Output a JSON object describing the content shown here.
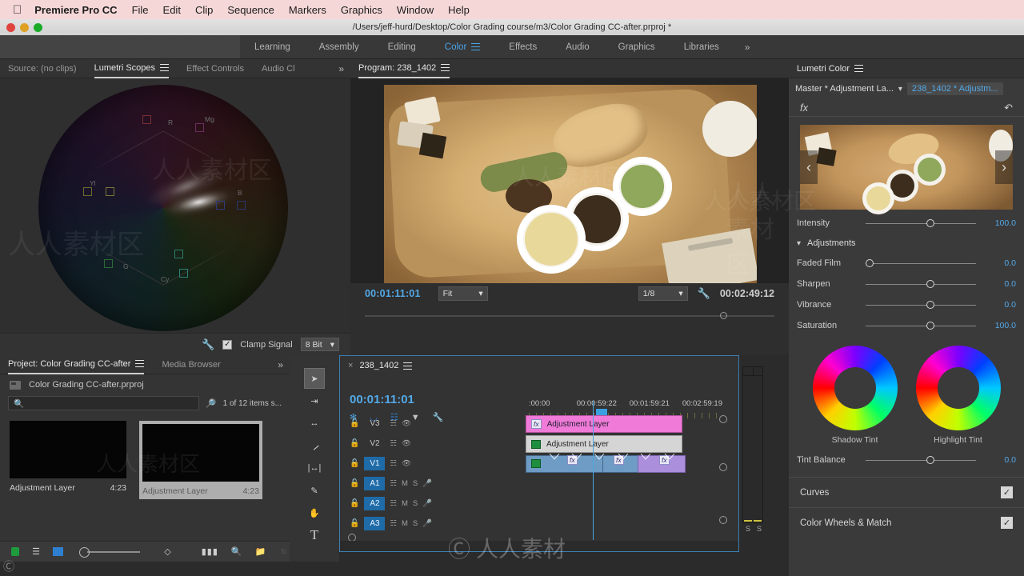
{
  "macbar": {
    "apple": "apple-logo",
    "app": "Premiere Pro CC",
    "menus": [
      "File",
      "Edit",
      "Clip",
      "Sequence",
      "Markers",
      "Graphics",
      "Window",
      "Help"
    ]
  },
  "titlebar": {
    "path": "/Users/jeff-hurd/Desktop/Color Grading course/m3/Color Grading CC-after.prproj *"
  },
  "workspace": {
    "tabs": [
      "Learning",
      "Assembly",
      "Editing",
      "Color",
      "Effects",
      "Audio",
      "Graphics",
      "Libraries"
    ],
    "active": "Color",
    "overflow": "»"
  },
  "scopes": {
    "tabs": [
      "Source: (no clips)",
      "Lumetri Scopes",
      "Effect Controls",
      "Audio Cl"
    ],
    "active": "Lumetri Scopes",
    "overflow": "»",
    "vector_labels": [
      "R",
      "Mg",
      "Yl",
      "B",
      "G",
      "Cy"
    ],
    "footer": {
      "wrench": "wrench-icon",
      "clamp_label": "Clamp Signal",
      "clamp_checked": true,
      "bitdepth": "8 Bit"
    }
  },
  "program": {
    "tab": "Program: 238_1402",
    "current_time": "00:01:11:01",
    "fit": "Fit",
    "resolution": "1/8",
    "duration": "00:02:49:12",
    "wrench": "wrench-icon"
  },
  "project": {
    "tabs": [
      "Project: Color Grading CC-after",
      "Media Browser"
    ],
    "active": "Project: Color Grading CC-after",
    "overflow": "»",
    "file": "Color Grading CC-after.prproj",
    "search_placeholder": "",
    "item_count": "1 of 12 items s...",
    "items": [
      {
        "name": "Adjustment Layer",
        "duration": "4:23",
        "selected": false
      },
      {
        "name": "Adjustment Layer",
        "duration": "4:23",
        "selected": true
      }
    ],
    "footer_icons": [
      "new-bin-icon",
      "list-view-icon",
      "icon-view-icon",
      "zoom-slider",
      "sort-icon",
      "freeform-icon",
      "find-icon",
      "new-bin-folder-icon",
      "new-item-icon"
    ]
  },
  "tools": [
    "selection-tool",
    "track-select-forward-tool",
    "ripple-edit-tool",
    "razor-tool",
    "slip-tool",
    "pen-tool",
    "hand-tool",
    "type-tool"
  ],
  "timeline": {
    "close": "×",
    "name": "238_1402",
    "menu": "panel-menu-icon",
    "playhead_time": "00:01:11:01",
    "ruler_labels": [
      ":00:00",
      "00:00:59:22",
      "00:01:59:21",
      "00:02:59:19"
    ],
    "header_icons": [
      "snap-sequence-icon",
      "magnet-icon",
      "linked-selection-icon",
      "marker-icon",
      "settings-wrench-icon"
    ],
    "video_tracks": [
      {
        "name": "V3",
        "active": false,
        "eye": true
      },
      {
        "name": "V2",
        "active": false,
        "eye": true
      },
      {
        "name": "V1",
        "active": true,
        "eye": true
      }
    ],
    "audio_tracks": [
      {
        "name": "A1",
        "active": true,
        "m": "M",
        "s": "S"
      },
      {
        "name": "A2",
        "active": true,
        "m": "M",
        "s": "S"
      },
      {
        "name": "A3",
        "active": true,
        "m": "M",
        "s": "S"
      }
    ],
    "clips": [
      {
        "track": "V3",
        "label": "Adjustment Layer",
        "color": "#f07ad8",
        "fx": true
      },
      {
        "track": "V2",
        "label": "Adjustment Layer",
        "color": "#d5d5d5",
        "fx": false
      }
    ],
    "meter_labels": [
      "S",
      "S"
    ]
  },
  "lumetri": {
    "title": "Lumetri Color",
    "menu": "panel-menu-icon",
    "master_label": "Master * Adjustment La...",
    "chevron": "chevron-down-icon",
    "clip_label": "238_1402 * Adjustm...",
    "fx_label": "fx",
    "reset": "reset-icon",
    "prev_arrow": "‹",
    "next_arrow": "›",
    "intensity": {
      "label": "Intensity",
      "value": "100.0",
      "pos": 55
    },
    "adjustments_label": "Adjustments",
    "adjustments": [
      {
        "label": "Faded Film",
        "value": "0.0",
        "pos": 0
      },
      {
        "label": "Sharpen",
        "value": "0.0",
        "pos": 55
      },
      {
        "label": "Vibrance",
        "value": "0.0",
        "pos": 55
      },
      {
        "label": "Saturation",
        "value": "100.0",
        "pos": 55
      }
    ],
    "wheels": [
      {
        "label": "Shadow Tint"
      },
      {
        "label": "Highlight Tint"
      }
    ],
    "tint_balance": {
      "label": "Tint Balance",
      "value": "0.0",
      "pos": 55
    },
    "sections": [
      {
        "label": "Curves",
        "checked": true
      },
      {
        "label": "Color Wheels & Match",
        "checked": true
      }
    ],
    "accent": "#53a9e8"
  }
}
